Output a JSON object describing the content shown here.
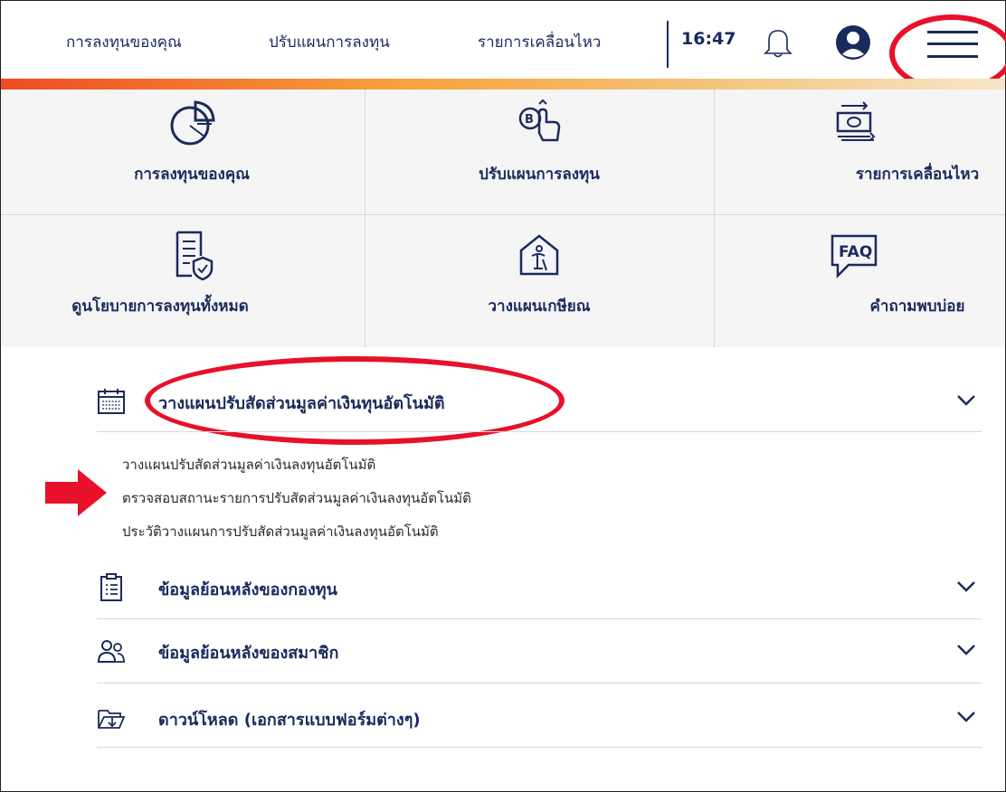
{
  "header": {
    "nav": [
      "การลงทุนของคุณ",
      "ปรับแผนการลงทุน",
      "รายการเคลื่อนไหว"
    ],
    "time": "16:47"
  },
  "grid": [
    {
      "label": "การลงทุนของคุณ",
      "icon": "pie-chart-icon"
    },
    {
      "label": "ปรับแผนการลงทุน",
      "icon": "baht-hand-icon"
    },
    {
      "label": "รายการเคลื่อนไหว",
      "icon": "money-transfer-icon"
    },
    {
      "label": "ดูนโยบายการลงทุนทั้งหมด",
      "icon": "policy-document-icon"
    },
    {
      "label": "วางแผนเกษียณ",
      "icon": "retirement-house-icon"
    },
    {
      "label": "คำถามพบบ่อย",
      "icon": "faq-icon",
      "icon_text": "FAQ"
    }
  ],
  "menu": {
    "rebalance": {
      "label": "วางแผนปรับสัดส่วนมูลค่าเงินทุนอัตโนมัติ",
      "sub_items": [
        "วางแผนปรับสัดส่วนมูลค่าเงินลงทุนอัตโนมัติ",
        "ตรวจสอบสถานะรายการปรับสัดส่วนมูลค่าเงินลงทุนอัตโนมัติ",
        "ประวัติวางแผนการปรับสัดส่วนมูลค่าเงินลงทุนอัตโนมัติ"
      ]
    },
    "fund_history": {
      "label": "ข้อมูลย้อนหลังของกองทุน"
    },
    "member_history": {
      "label": "ข้อมูลย้อนหลังของสมาชิก"
    },
    "download": {
      "label": "ดาวน์โหลด (เอกสารแบบฟอร์มต่างๆ)"
    }
  },
  "colors": {
    "brand_navy": "#1a2a5c",
    "annotation_red": "#e8102a",
    "accent_orange": "#f04a23"
  }
}
